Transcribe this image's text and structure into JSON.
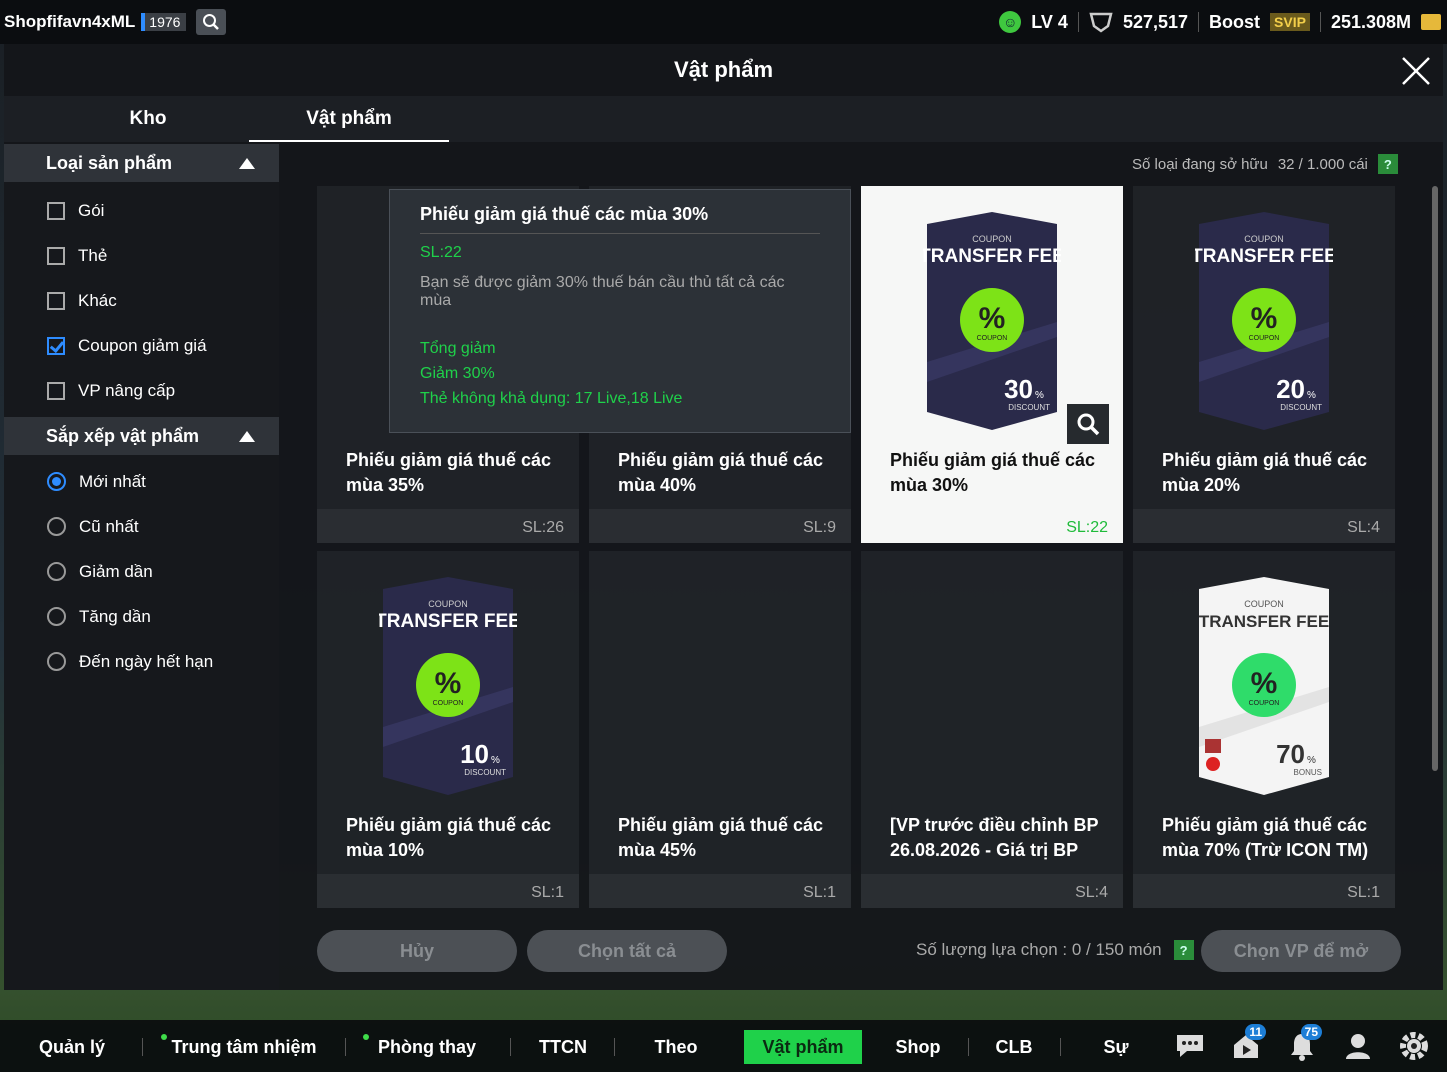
{
  "topbar": {
    "username": "Shopfifavn4xML",
    "user_id": "1976",
    "level": "LV 4",
    "bp": "527,517",
    "boost_label": "Boost",
    "svip": "SVIP",
    "balance": "251.308M"
  },
  "modal": {
    "title": "Vật phẩm",
    "tabs": [
      {
        "label": "Kho"
      },
      {
        "label": "Vật phẩm"
      }
    ]
  },
  "sidebar": {
    "filter_title": "Loại sản phẩm",
    "filters": [
      {
        "label": "Gói",
        "checked": false
      },
      {
        "label": "Thẻ",
        "checked": false
      },
      {
        "label": "Khác",
        "checked": false
      },
      {
        "label": "Coupon giảm giá",
        "checked": true
      },
      {
        "label": "VP nâng cấp",
        "checked": false
      }
    ],
    "sort_title": "Sắp xếp vật phẩm",
    "sorts": [
      {
        "label": "Mới nhất",
        "selected": true
      },
      {
        "label": "Cũ nhất",
        "selected": false
      },
      {
        "label": "Giảm dần",
        "selected": false
      },
      {
        "label": "Tăng dần",
        "selected": false
      },
      {
        "label": "Đến ngày hết hạn",
        "selected": false
      }
    ]
  },
  "content": {
    "owned_label": "Số loại đang sở hữu",
    "owned_value": "32 / 1.000 cái",
    "help": "?",
    "items": [
      {
        "name": "Phiếu giảm giá thuế các mùa 35%",
        "qty": "SL:26"
      },
      {
        "name": "Phiếu giảm giá thuế các mùa 40%",
        "qty": "SL:9"
      },
      {
        "name": "Phiếu giảm giá thuế các mùa 30%",
        "qty": "SL:22",
        "card": {
          "top": "COUPON",
          "title": "TRANSFER FEE",
          "badge": "COUPON",
          "pct": "30",
          "foot": "DISCOUNT"
        }
      },
      {
        "name": "Phiếu giảm giá thuế các mùa 20%",
        "qty": "SL:4",
        "card": {
          "top": "COUPON",
          "title": "TRANSFER FEE",
          "badge": "COUPON",
          "pct": "20",
          "foot": "DISCOUNT"
        }
      },
      {
        "name": "Phiếu giảm giá thuế các mùa 10%",
        "qty": "SL:1",
        "card": {
          "top": "COUPON",
          "title": "TRANSFER FEE",
          "badge": "COUPON",
          "pct": "10",
          "foot": "DISCOUNT"
        }
      },
      {
        "name": "Phiếu giảm giá thuế các mùa 45%",
        "qty": "SL:1"
      },
      {
        "name": "[VP trước điều chỉnh BP 26.08.2026 - Giá trị BP",
        "qty": "SL:4"
      },
      {
        "name": "Phiếu giảm giá thuế các mùa 70% (Trừ ICON TM)",
        "qty": "SL:1",
        "card": {
          "top": "COUPON",
          "title": "TRANSFER FEE",
          "badge": "COUPON",
          "pct": "70",
          "foot": "BONUS"
        }
      }
    ],
    "tooltip": {
      "title": "Phiếu giảm giá thuế các mùa 30%",
      "qty": "SL:22",
      "desc": "Bạn sẽ được giảm 30% thuế bán cầu thủ tất cả các mùa",
      "line1": "Tổng giảm",
      "line2": "Giảm 30%",
      "line3": "Thẻ không khả dụng: 17 Live,18 Live"
    },
    "cancel_btn": "Hủy",
    "select_all_btn": "Chọn tất cả",
    "select_count": "Số lượng lựa chọn : 0 / 150 món",
    "open_btn": "Chọn VP để mở"
  },
  "nav": {
    "items": [
      "Quản lý CT",
      "Trung tâm nhiệm vụ",
      "Phòng thay đồ",
      "TTCN",
      "Theo dõi",
      "Vật phẩm",
      "Shop",
      "CLB",
      "Sự kiện"
    ],
    "badge_play": "11",
    "badge_bell": "75"
  },
  "colors": {
    "accent": "#1fd14a",
    "checkbox": "#2e8cff",
    "card_dark": "#2a2a4a"
  }
}
